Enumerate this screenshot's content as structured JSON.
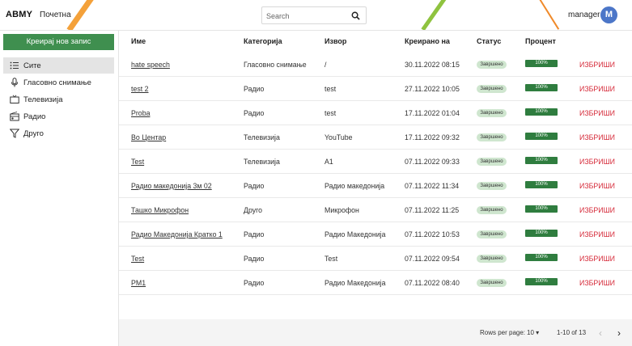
{
  "header": {
    "brand": "ABMY",
    "home_link": "Почетна",
    "search_placeholder": "Search",
    "user_name": "manager",
    "avatar_letter": "M"
  },
  "sidebar": {
    "create_button": "Креирај нов запис",
    "items": [
      {
        "label": "Сите",
        "icon": "list-icon",
        "active": true
      },
      {
        "label": "Гласовно снимање",
        "icon": "microphone-icon",
        "active": false
      },
      {
        "label": "Телевизија",
        "icon": "tv-icon",
        "active": false
      },
      {
        "label": "Радио",
        "icon": "radio-icon",
        "active": false
      },
      {
        "label": "Друго",
        "icon": "filter-icon",
        "active": false
      }
    ]
  },
  "table": {
    "columns": [
      "Име",
      "Категорија",
      "Извор",
      "Креирано на",
      "Статус",
      "Процент"
    ],
    "rows": [
      {
        "name": "hate speech",
        "category": "Гласовно снимање",
        "source": "/",
        "created": "30.11.2022 08:15",
        "status": "Завршено",
        "percent": "100%",
        "action": "ИЗБРИШИ"
      },
      {
        "name": "test 2",
        "category": "Радио",
        "source": "test",
        "created": "27.11.2022 10:05",
        "status": "Завршено",
        "percent": "100%",
        "action": "ИЗБРИШИ"
      },
      {
        "name": "Proba",
        "category": "Радио",
        "source": "test",
        "created": "17.11.2022 01:04",
        "status": "Завршено",
        "percent": "100%",
        "action": "ИЗБРИШИ"
      },
      {
        "name": "Во Центар",
        "category": "Телевизија",
        "source": "YouTube",
        "created": "17.11.2022 09:32",
        "status": "Завршено",
        "percent": "100%",
        "action": "ИЗБРИШИ"
      },
      {
        "name": "Test",
        "category": "Телевизија",
        "source": "A1",
        "created": "07.11.2022 09:33",
        "status": "Завршено",
        "percent": "100%",
        "action": "ИЗБРИШИ"
      },
      {
        "name": "Радио македонија 3м 02",
        "category": "Радио",
        "source": "Радио македонија",
        "created": "07.11.2022 11:34",
        "status": "Завршено",
        "percent": "100%",
        "action": "ИЗБРИШИ"
      },
      {
        "name": "Ташко Микрофон",
        "category": "Друго",
        "source": "Микрофон",
        "created": "07.11.2022 11:25",
        "status": "Завршено",
        "percent": "100%",
        "action": "ИЗБРИШИ"
      },
      {
        "name": "Радио Македонија Кратко 1",
        "category": "Радио",
        "source": "Радио Македонија",
        "created": "07.11.2022 10:53",
        "status": "Завршено",
        "percent": "100%",
        "action": "ИЗБРИШИ"
      },
      {
        "name": "Test",
        "category": "Радио",
        "source": "Test",
        "created": "07.11.2022 09:54",
        "status": "Завршено",
        "percent": "100%",
        "action": "ИЗБРИШИ"
      },
      {
        "name": "PM1",
        "category": "Радио",
        "source": "Радио Македонија",
        "created": "07.11.2022 08:40",
        "status": "Завршено",
        "percent": "100%",
        "action": "ИЗБРИШИ"
      }
    ]
  },
  "pagination": {
    "rows_per_page_label": "Rows per page:",
    "rows_per_page_value": "10",
    "range": "1-10 of 13"
  },
  "colors": {
    "primary_green": "#3f8f4f",
    "progress_green": "#2f7d3f",
    "status_pill": "#cfe6cf",
    "delete_red": "#d62b3a",
    "avatar_blue": "#4c76c8"
  }
}
